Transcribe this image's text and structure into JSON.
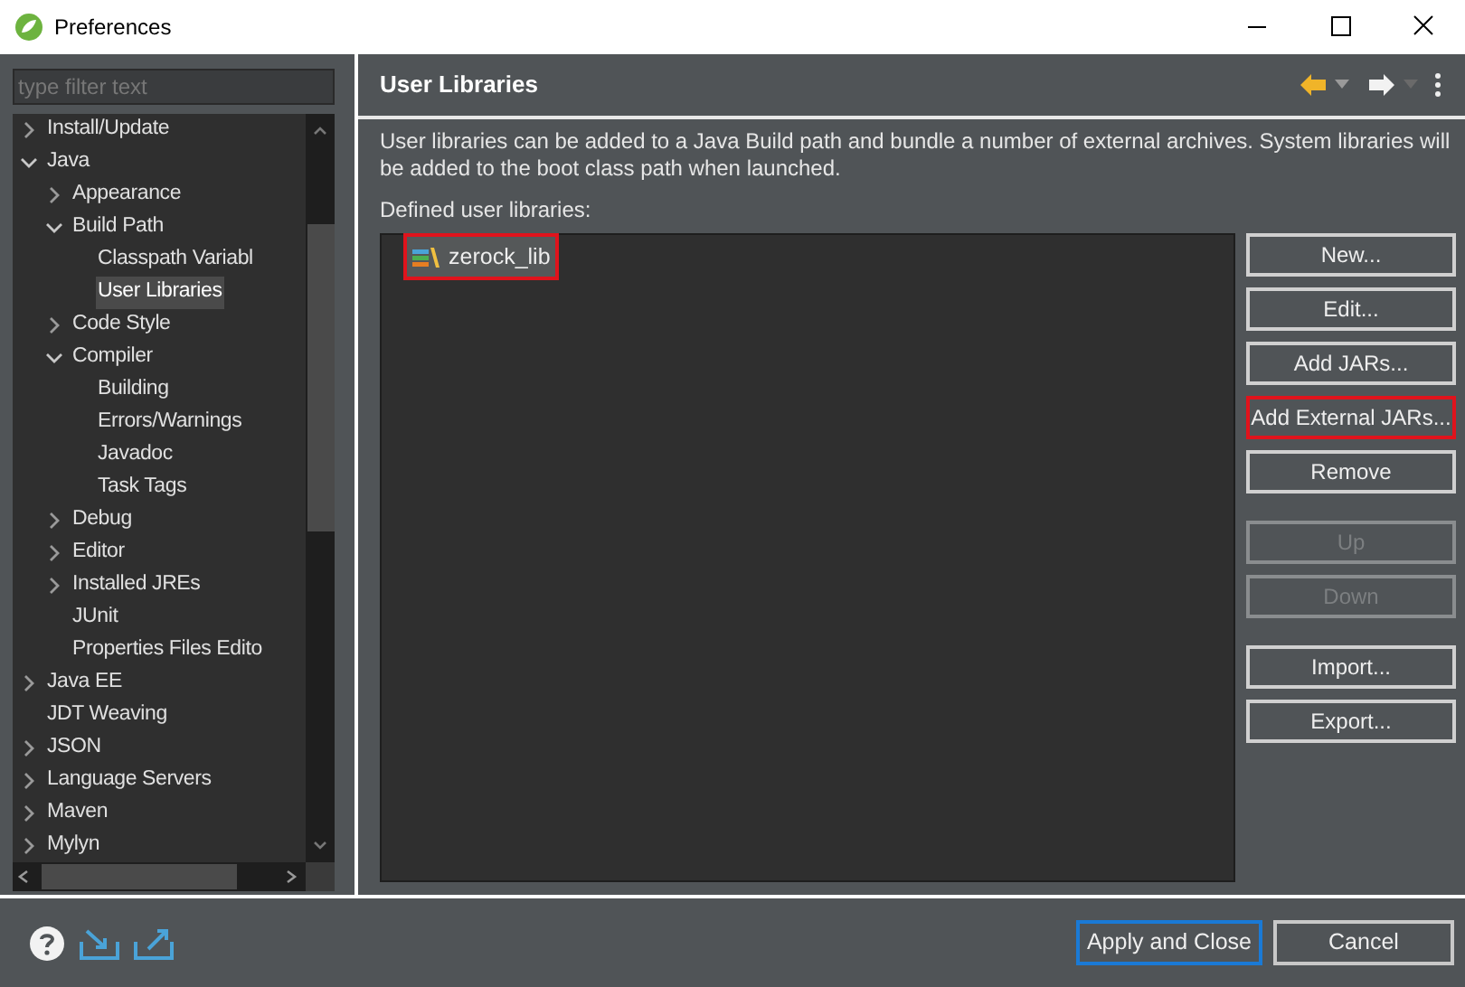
{
  "window": {
    "title": "Preferences"
  },
  "filter": {
    "placeholder": "type filter text"
  },
  "tree": [
    {
      "label": "Install/Update",
      "expanded": false,
      "has_children": true,
      "selected": false
    },
    {
      "label": "Java",
      "expanded": true,
      "has_children": true,
      "selected": false,
      "children": [
        {
          "label": "Appearance",
          "expanded": false,
          "has_children": true,
          "selected": false
        },
        {
          "label": "Build Path",
          "expanded": true,
          "has_children": true,
          "selected": false,
          "children": [
            {
              "label": "Classpath Variabl",
              "has_children": false,
              "selected": false
            },
            {
              "label": "User Libraries",
              "has_children": false,
              "selected": true
            }
          ]
        },
        {
          "label": "Code Style",
          "expanded": false,
          "has_children": true,
          "selected": false
        },
        {
          "label": "Compiler",
          "expanded": true,
          "has_children": true,
          "selected": false,
          "children": [
            {
              "label": "Building",
              "has_children": false,
              "selected": false
            },
            {
              "label": "Errors/Warnings",
              "has_children": false,
              "selected": false
            },
            {
              "label": "Javadoc",
              "has_children": false,
              "selected": false
            },
            {
              "label": "Task Tags",
              "has_children": false,
              "selected": false
            }
          ]
        },
        {
          "label": "Debug",
          "expanded": false,
          "has_children": true,
          "selected": false
        },
        {
          "label": "Editor",
          "expanded": false,
          "has_children": true,
          "selected": false
        },
        {
          "label": "Installed JREs",
          "expanded": false,
          "has_children": true,
          "selected": false
        },
        {
          "label": "JUnit",
          "has_children": false,
          "selected": false
        },
        {
          "label": "Properties Files Edito",
          "has_children": false,
          "selected": false
        }
      ]
    },
    {
      "label": "Java EE",
      "expanded": false,
      "has_children": true,
      "selected": false
    },
    {
      "label": "JDT Weaving",
      "has_children": false,
      "selected": false
    },
    {
      "label": "JSON",
      "expanded": false,
      "has_children": true,
      "selected": false
    },
    {
      "label": "Language Servers",
      "expanded": false,
      "has_children": true,
      "selected": false
    },
    {
      "label": "Maven",
      "expanded": false,
      "has_children": true,
      "selected": false
    },
    {
      "label": "Mylyn",
      "expanded": false,
      "has_children": true,
      "selected": false
    }
  ],
  "page": {
    "title": "User Libraries",
    "description": "User libraries can be added to a Java Build path and bundle a number of external archives. System libraries will be added to the boot class path when launched.",
    "list_label": "Defined user libraries:",
    "libraries": [
      {
        "name": "zerock_lib",
        "selected": true,
        "highlighted": true
      }
    ],
    "button_groups": [
      [
        {
          "label": "New...",
          "disabled": false,
          "highlighted": false
        },
        {
          "label": "Edit...",
          "disabled": false,
          "highlighted": false
        },
        {
          "label": "Add JARs...",
          "disabled": false,
          "highlighted": false
        },
        {
          "label": "Add External JARs...",
          "disabled": false,
          "highlighted": true
        },
        {
          "label": "Remove",
          "disabled": false,
          "highlighted": false
        }
      ],
      [
        {
          "label": "Up",
          "disabled": true,
          "highlighted": false
        },
        {
          "label": "Down",
          "disabled": true,
          "highlighted": false
        }
      ],
      [
        {
          "label": "Import...",
          "disabled": false,
          "highlighted": false
        },
        {
          "label": "Export...",
          "disabled": false,
          "highlighted": false
        }
      ]
    ]
  },
  "footer": {
    "buttons": [
      {
        "label": "Apply and Close",
        "focused": true
      },
      {
        "label": "Cancel",
        "focused": false
      }
    ]
  }
}
